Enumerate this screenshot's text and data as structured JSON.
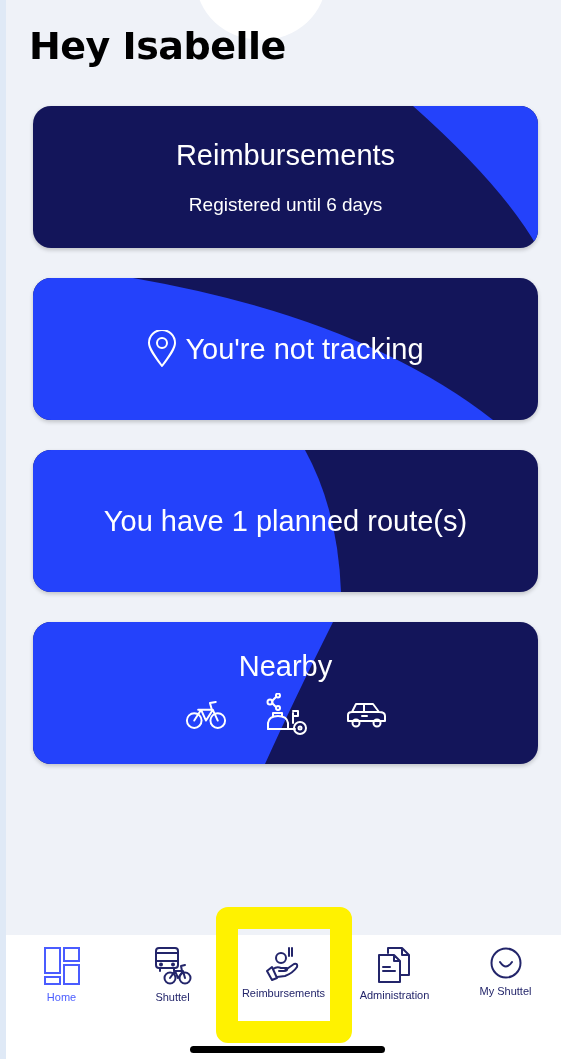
{
  "greeting": "Hey Isabelle",
  "cards": [
    {
      "kind": "reimbursements",
      "title": "Reimbursements",
      "subtitle": "Registered until 6 days"
    },
    {
      "kind": "tracking",
      "title": "You're not tracking"
    },
    {
      "kind": "routes",
      "title": "You have 1 planned route(s)"
    },
    {
      "kind": "nearby",
      "title": "Nearby"
    }
  ],
  "nav": [
    {
      "kind": "home",
      "label": "Home",
      "selected": true,
      "highlighted": false
    },
    {
      "kind": "shuttel",
      "label": "Shuttel",
      "selected": false,
      "highlighted": false
    },
    {
      "kind": "reimbursements",
      "label": "Reimbursements",
      "selected": false,
      "highlighted": true
    },
    {
      "kind": "administration",
      "label": "Administration",
      "selected": false,
      "highlighted": false
    },
    {
      "kind": "profile",
      "label": "My Shuttel",
      "selected": false,
      "highlighted": false
    }
  ]
}
